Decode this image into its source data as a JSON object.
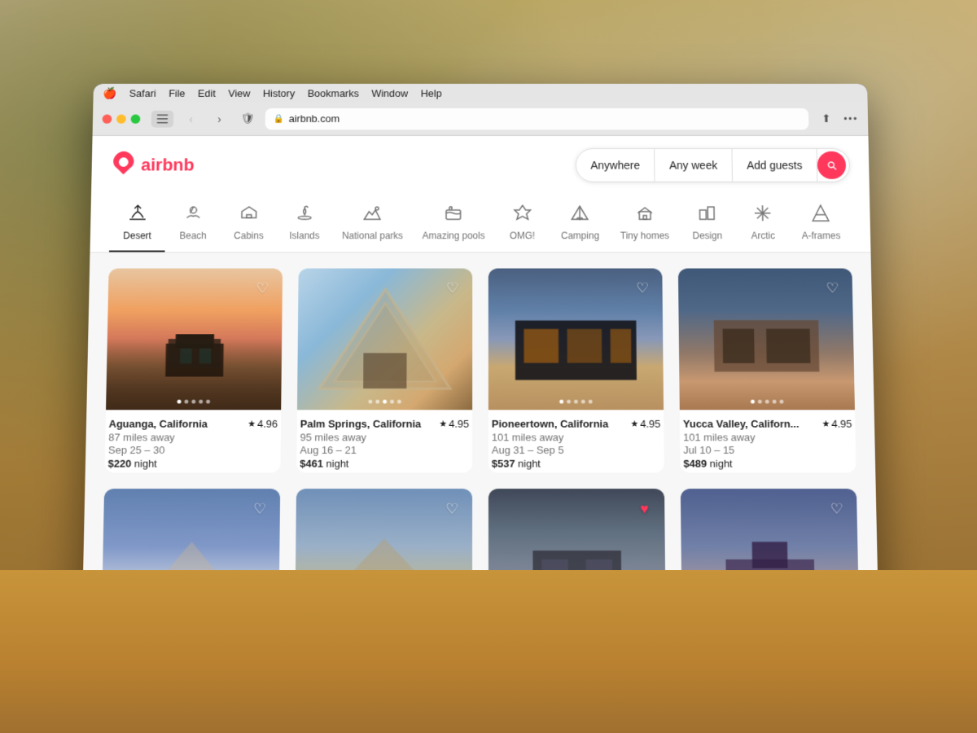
{
  "menu": {
    "apple": "🍎",
    "items": [
      "Safari",
      "File",
      "Edit",
      "View",
      "History",
      "Bookmarks",
      "Window",
      "Help"
    ]
  },
  "toolbar": {
    "address": "airbnb.com",
    "shield": "🛡",
    "share": "⬆"
  },
  "header": {
    "logo_icon": "✈",
    "logo_text": "airbnb",
    "search": {
      "anywhere": "Anywhere",
      "any_week": "Any week",
      "add_guests": "Add guests"
    }
  },
  "categories": [
    {
      "id": "desert",
      "icon": "🌵",
      "label": "Desert",
      "active": true
    },
    {
      "id": "beach",
      "icon": "⛱",
      "label": "Beach",
      "active": false
    },
    {
      "id": "cabins",
      "icon": "🏠",
      "label": "Cabins",
      "active": false
    },
    {
      "id": "islands",
      "icon": "🏝",
      "label": "Islands",
      "active": false
    },
    {
      "id": "national-parks",
      "icon": "⛰",
      "label": "National parks",
      "active": false
    },
    {
      "id": "amazing-pools",
      "icon": "🏊",
      "label": "Amazing pools",
      "active": false
    },
    {
      "id": "omg",
      "icon": "🛸",
      "label": "OMG!",
      "active": false
    },
    {
      "id": "camping",
      "icon": "⛺",
      "label": "Camping",
      "active": false
    },
    {
      "id": "tiny-homes",
      "icon": "🏡",
      "label": "Tiny homes",
      "active": false
    },
    {
      "id": "design",
      "icon": "🏗",
      "label": "Design",
      "active": false
    },
    {
      "id": "arctic",
      "icon": "❄",
      "label": "Arctic",
      "active": false
    },
    {
      "id": "a-frames",
      "icon": "🔺",
      "label": "A-frames",
      "active": false
    }
  ],
  "listings": [
    {
      "location": "Aguanga, California",
      "rating": "4.96",
      "distance": "87 miles away",
      "dates": "Sep 25 – 30",
      "price": "$220",
      "price_unit": "night",
      "img_class": "img-aguanga",
      "dots": 5,
      "active_dot": 0,
      "wishlisted": false
    },
    {
      "location": "Palm Springs, California",
      "rating": "4.95",
      "distance": "95 miles away",
      "dates": "Aug 16 – 21",
      "price": "$461",
      "price_unit": "night",
      "img_class": "img-palm-springs",
      "dots": 5,
      "active_dot": 2,
      "wishlisted": false
    },
    {
      "location": "Pioneertown, California",
      "rating": "4.95",
      "distance": "101 miles away",
      "dates": "Aug 31 – Sep 5",
      "price": "$537",
      "price_unit": "night",
      "img_class": "img-pioneertown",
      "dots": 5,
      "active_dot": 0,
      "wishlisted": false
    },
    {
      "location": "Yucca Valley, Californ...",
      "rating": "4.95",
      "distance": "101 miles away",
      "dates": "Jul 10 – 15",
      "price": "$489",
      "price_unit": "night",
      "img_class": "img-yucca",
      "dots": 5,
      "active_dot": 0,
      "wishlisted": false
    },
    {
      "location": "",
      "rating": "",
      "distance": "",
      "dates": "",
      "price": "",
      "price_unit": "",
      "img_class": "img-row2-1",
      "dots": 0,
      "active_dot": 0,
      "wishlisted": false
    },
    {
      "location": "",
      "rating": "",
      "distance": "",
      "dates": "",
      "price": "",
      "price_unit": "",
      "img_class": "img-row2-2",
      "dots": 0,
      "active_dot": 0,
      "wishlisted": false
    },
    {
      "location": "",
      "rating": "",
      "distance": "",
      "dates": "",
      "price": "",
      "price_unit": "",
      "img_class": "img-row2-3",
      "dots": 0,
      "active_dot": 0,
      "wishlisted": true
    },
    {
      "location": "",
      "rating": "",
      "distance": "",
      "dates": "",
      "price": "",
      "price_unit": "",
      "img_class": "img-row2-4",
      "dots": 0,
      "active_dot": 0,
      "wishlisted": false
    }
  ]
}
